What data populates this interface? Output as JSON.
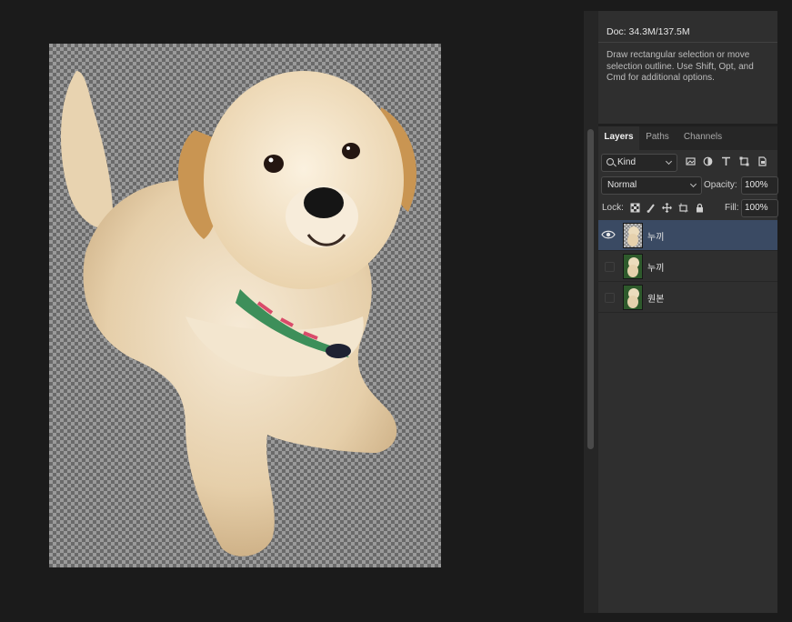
{
  "info": {
    "doc": "Doc: 34.3M/137.5M",
    "hint": "Draw rectangular selection or move selection outline.  Use Shift, Opt, and Cmd for additional options."
  },
  "tabs": [
    {
      "label": "Layers",
      "active": true
    },
    {
      "label": "Paths",
      "active": false
    },
    {
      "label": "Channels",
      "active": false
    }
  ],
  "filter": {
    "kind_label": "Kind",
    "icons": [
      "image-filter-icon",
      "adjustment-filter-icon",
      "type-filter-icon",
      "shape-filter-icon",
      "smart-object-filter-icon"
    ]
  },
  "blend": {
    "mode": "Normal",
    "opacity_label": "Opacity:",
    "opacity_value": "100%"
  },
  "lock": {
    "label": "Lock:",
    "icons": [
      "lock-transparent-pixels-icon",
      "lock-image-pixels-icon",
      "lock-position-icon",
      "lock-artboard-icon",
      "lock-all-icon"
    ],
    "fill_label": "Fill:",
    "fill_value": "100%"
  },
  "layers": [
    {
      "name": "누끼",
      "visible": true,
      "selected": true,
      "thumb": "cutout"
    },
    {
      "name": "누끼",
      "visible": false,
      "selected": false,
      "thumb": "photo"
    },
    {
      "name": "원본",
      "visible": false,
      "selected": false,
      "thumb": "photo"
    }
  ],
  "colors": {
    "selected_layer": "#3a4a63",
    "panel_bg": "#2f2f2f",
    "app_bg": "#1b1b1b"
  }
}
